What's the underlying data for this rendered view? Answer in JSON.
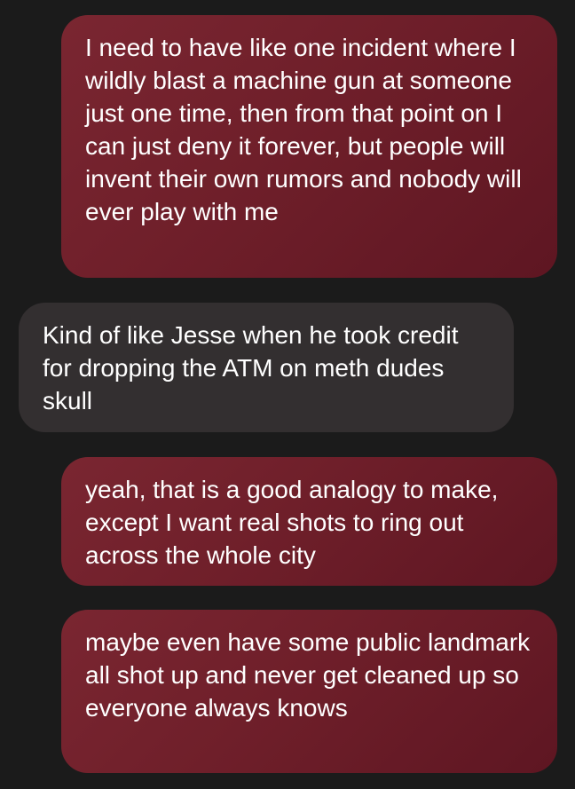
{
  "conversation": {
    "messages": [
      {
        "direction": "outgoing",
        "text": "I need to have like one incident where I wildly blast a machine gun at someone just one time, then from that point on I can just deny it forever, but people will invent their own rumors and nobody will ever play with me"
      },
      {
        "direction": "incoming",
        "text": "Kind of like Jesse when he took credit for dropping the ATM on meth dudes skull"
      },
      {
        "direction": "outgoing",
        "text": "yeah, that is a good analogy to make, except I want real shots to ring out across the whole city"
      },
      {
        "direction": "outgoing",
        "text": "maybe even have some public landmark all shot up and never get cleaned up so everyone always knows"
      }
    ]
  },
  "colors": {
    "background": "#1b1b1b",
    "outgoing_bubble": "#6f1f2a",
    "incoming_bubble": "#332f30",
    "text": "#ffffff"
  }
}
